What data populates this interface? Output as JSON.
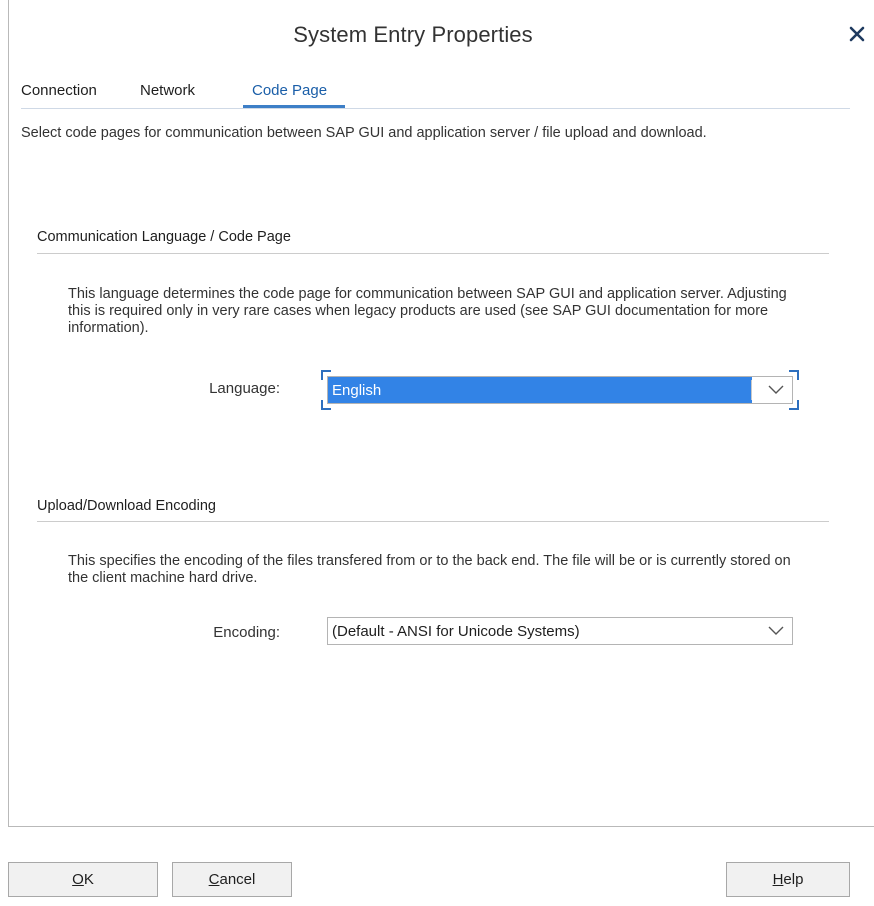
{
  "dialog": {
    "title": "System Entry Properties"
  },
  "tabs": [
    {
      "label": "Connection",
      "active": false
    },
    {
      "label": "Network",
      "active": false
    },
    {
      "label": "Code Page",
      "active": true
    }
  ],
  "intro_text": "Select code pages for communication between SAP GUI and application server / file upload and download.",
  "communication_section": {
    "title": "Communication Language / Code Page",
    "description": "This language determines the code page for communication between SAP GUI and application server. Adjusting this is required only in very rare cases when legacy products are used (see SAP GUI documentation for more information).",
    "language_label": "Language:",
    "language_value": "English"
  },
  "encoding_section": {
    "title": "Upload/Download Encoding",
    "description": "This specifies the encoding of the files transfered from or to the back end. The file will be or is currently stored on the client machine hard drive.",
    "encoding_label": "Encoding:",
    "encoding_value": "(Default - ANSI for Unicode Systems)"
  },
  "footer": {
    "ok": {
      "mnemonic": "O",
      "rest": "K"
    },
    "cancel": {
      "mnemonic": "C",
      "rest": "ancel"
    },
    "help": {
      "mnemonic": "H",
      "rest": "elp"
    }
  },
  "colors": {
    "accent": "#3d7fc7",
    "selection": "#3283e6"
  }
}
